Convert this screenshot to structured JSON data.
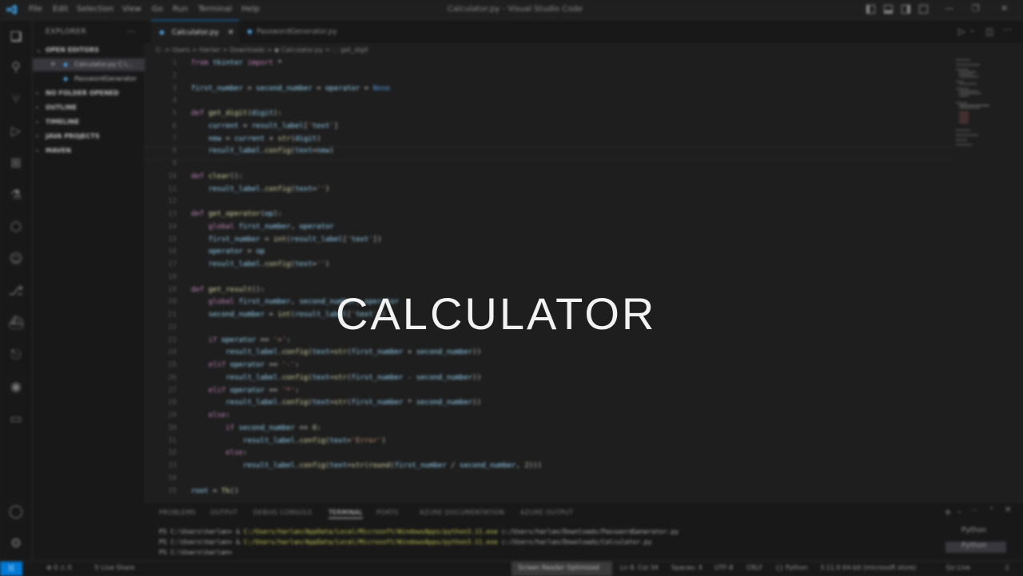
{
  "titlebar": {
    "menu": [
      "File",
      "Edit",
      "Selection",
      "View",
      "Go",
      "Run",
      "Terminal",
      "Help"
    ],
    "window_title": "Calculator.py - Visual Studio Code",
    "controls": [
      "—",
      "❐",
      "✕"
    ]
  },
  "activity_icons": [
    "explorer-icon",
    "search-icon",
    "source-control-icon",
    "run-debug-icon",
    "extensions-icon",
    "testing-icon",
    "package-icon",
    "chat-icon",
    "git-icon",
    "docker-icon",
    "remote-icon",
    "python-icon",
    "comment-icon",
    "account-icon",
    "settings-gear-icon"
  ],
  "sidebar": {
    "header": "EXPLORER",
    "open_editors_label": "OPEN EDITORS",
    "open_editors": [
      {
        "label": "Calculator.py  C:\\...",
        "selected": true
      },
      {
        "label": "PasswordGenerator",
        "selected": false
      }
    ],
    "sections": [
      "NO FOLDER OPENED",
      "OUTLINE",
      "TIMELINE",
      "JAVA PROJECTS",
      "MAVEN"
    ]
  },
  "tabs": [
    {
      "label": "Calculator.py",
      "active": true
    },
    {
      "label": "PasswordGenerator.py",
      "active": false
    }
  ],
  "breadcrumb": "C: > Users > Harlan > Downloads > ◆ Calculator.py > ⬚ get_digit",
  "code": [
    {
      "n": "1",
      "t": "from tkinter import *"
    },
    {
      "n": "2",
      "t": ""
    },
    {
      "n": "3",
      "t": "first_number = second_number = operator = None"
    },
    {
      "n": "4",
      "t": ""
    },
    {
      "n": "5",
      "t": "def get_digit(digit):"
    },
    {
      "n": "6",
      "t": "    current = result_label['text']"
    },
    {
      "n": "7",
      "t": "    new = current + str(digit)"
    },
    {
      "n": "8",
      "t": "    result_label.config(text=new)"
    },
    {
      "n": "9",
      "t": ""
    },
    {
      "n": "10",
      "t": "def clear():"
    },
    {
      "n": "11",
      "t": "    result_label.config(text='')"
    },
    {
      "n": "12",
      "t": ""
    },
    {
      "n": "13",
      "t": "def get_operator(op):"
    },
    {
      "n": "14",
      "t": "    global first_number, operator"
    },
    {
      "n": "15",
      "t": "    first_number = int(result_label['text'])"
    },
    {
      "n": "16",
      "t": "    operator = op"
    },
    {
      "n": "17",
      "t": "    result_label.config(text='')"
    },
    {
      "n": "18",
      "t": ""
    },
    {
      "n": "19",
      "t": "def get_result():"
    },
    {
      "n": "20",
      "t": "    global first_number, second_number, operator"
    },
    {
      "n": "21",
      "t": "    second_number = int(result_label['text'])"
    },
    {
      "n": "22",
      "t": ""
    },
    {
      "n": "23",
      "t": "    if operator == '+':"
    },
    {
      "n": "24",
      "t": "        result_label.config(text=str(first_number + second_number))"
    },
    {
      "n": "25",
      "t": "    elif operator == '-':"
    },
    {
      "n": "26",
      "t": "        result_label.config(text=str(first_number - second_number))"
    },
    {
      "n": "27",
      "t": "    elif operator == '*':"
    },
    {
      "n": "28",
      "t": "        result_label.config(text=str(first_number * second_number))"
    },
    {
      "n": "29",
      "t": "    else:"
    },
    {
      "n": "30",
      "t": "        if second_number == 0:"
    },
    {
      "n": "31",
      "t": "            result_label.config(text='Error')"
    },
    {
      "n": "32",
      "t": "        else:"
    },
    {
      "n": "33",
      "t": "            result_label.config(text=str(round(first_number / second_number, 2)))"
    },
    {
      "n": "34",
      "t": ""
    },
    {
      "n": "35",
      "t": "root = Tk()"
    }
  ],
  "overlay_title": "CALCULATOR",
  "panel": {
    "tabs": [
      "PROBLEMS",
      "OUTPUT",
      "DEBUG CONSOLE",
      "TERMINAL",
      "PORTS",
      "AZURE DOCUMENTATION",
      "AZURE OUTPUT"
    ],
    "active_tab": "TERMINAL",
    "terminal_lines": [
      {
        "prompt": "PS C:\\Users\\harlan> & ",
        "path": "C:/Users/harlan/AppData/Local/Microsoft/WindowsApps/python3.11.exe",
        "rest": " c:/Users/harlan/Downloads/PasswordGenerator.py"
      },
      {
        "prompt": "PS C:\\Users\\harlan> & ",
        "path": "C:/Users/harlan/AppData/Local/Microsoft/WindowsApps/python3.11.exe",
        "rest": " c:/Users/harlan/Downloads/Calculator.py"
      },
      {
        "prompt": "PS C:\\Users\\harlan> ",
        "path": "",
        "rest": ""
      }
    ],
    "terminal_list": [
      "Python",
      "Python"
    ]
  },
  "statusbar": {
    "remote": "⟩⟨",
    "left_items": [
      "⊗ 0 ⚠ 0",
      "⚲ Live Share"
    ],
    "screen_reader": "Screen Reader Optimized",
    "right_items": [
      "Ln 8, Col 34",
      "Spaces: 4",
      "UTF-8",
      "CRLF",
      "{} Python",
      "3.11.9 64-bit (microsoft store)",
      "Go Live"
    ]
  }
}
